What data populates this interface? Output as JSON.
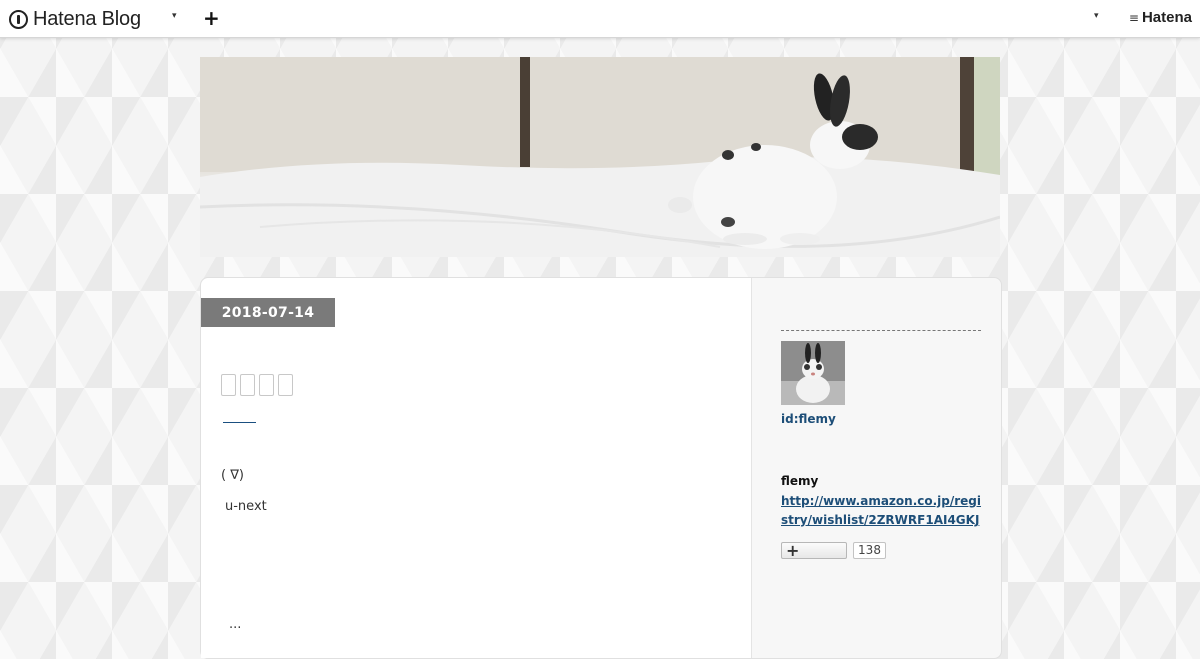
{
  "topbar": {
    "logo_text": "Hatena Blog",
    "logo_icon": "hatena-blog-logo-icon",
    "menu_caret": "▾",
    "add_label": "+",
    "right_caret": "▾",
    "hatena_text": "Hatena"
  },
  "header": {
    "image": "header-photo-rabbit"
  },
  "entry": {
    "date": "2018-07-14",
    "line1": "( ∇)",
    "line2": "u-next",
    "line3": "..."
  },
  "profile": {
    "id": "id:flemy",
    "name": "flemy",
    "url": "http://www.amazon.co.jp/registry/wishlist/2ZRWRF1AI4GKJ",
    "follow_icon": "+",
    "follow_count": "138"
  },
  "colors": {
    "link": "#1d4e78",
    "date_badge": "#7a7a7a"
  }
}
